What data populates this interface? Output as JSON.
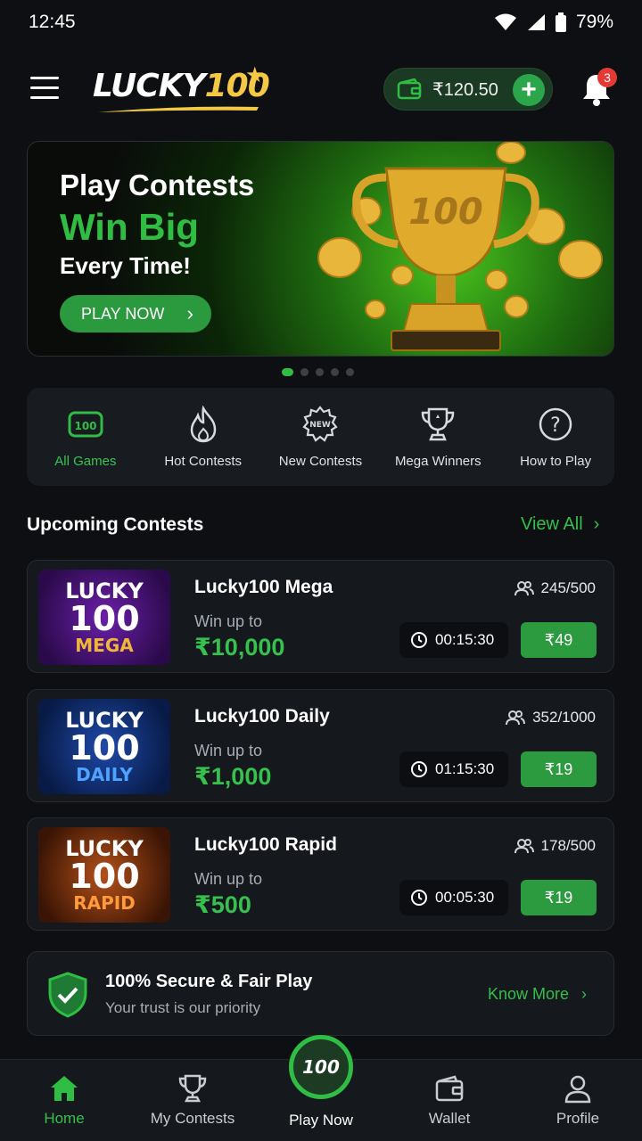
{
  "status": {
    "time": "12:45",
    "battery": "79%"
  },
  "header": {
    "logo_text": "LUCKY",
    "logo_number": "100",
    "wallet_amount": "₹120.50",
    "notification_count": "3"
  },
  "banner": {
    "line1": "Play Contests",
    "line2": "Win Big",
    "line3": "Every Time!",
    "button": "PLAY NOW",
    "trophy_text": "100",
    "dots_count": 5,
    "active_dot": 0
  },
  "categories": [
    {
      "label": "All Games",
      "icon": "game-icon",
      "active": true
    },
    {
      "label": "Hot Contests",
      "icon": "fire-icon",
      "active": false
    },
    {
      "label": "New Contests",
      "icon": "new-badge-icon",
      "active": false
    },
    {
      "label": "Mega Winners",
      "icon": "trophy-icon",
      "active": false
    },
    {
      "label": "How to Play",
      "icon": "question-icon",
      "active": false
    }
  ],
  "upcoming": {
    "title": "Upcoming Contests",
    "view_all": "View All",
    "contests": [
      {
        "thumb_top": "LUCKY",
        "thumb_num": "100",
        "thumb_bottom": "MEGA",
        "name": "Lucky100 Mega",
        "win_label": "Win up to",
        "prize": "₹10,000",
        "players": "245/500",
        "timer": "00:15:30",
        "fee": "₹49"
      },
      {
        "thumb_top": "LUCKY",
        "thumb_num": "100",
        "thumb_bottom": "DAILY",
        "name": "Lucky100 Daily",
        "win_label": "Win up to",
        "prize": "₹1,000",
        "players": "352/1000",
        "timer": "01:15:30",
        "fee": "₹19"
      },
      {
        "thumb_top": "LUCKY",
        "thumb_num": "100",
        "thumb_bottom": "RAPID",
        "name": "Lucky100 Rapid",
        "win_label": "Win up to",
        "prize": "₹500",
        "players": "178/500",
        "timer": "00:05:30",
        "fee": "₹19"
      }
    ]
  },
  "secure": {
    "title": "100% Secure & Fair Play",
    "subtitle": "Your trust is our priority",
    "link": "Know More"
  },
  "nav": {
    "home": "Home",
    "my_contests": "My Contests",
    "play_now": "Play Now",
    "play_badge": "100",
    "wallet": "Wallet",
    "profile": "Profile"
  },
  "colors": {
    "accent": "#2fbd43",
    "gold": "#f3c844",
    "background": "#0d0f12"
  }
}
